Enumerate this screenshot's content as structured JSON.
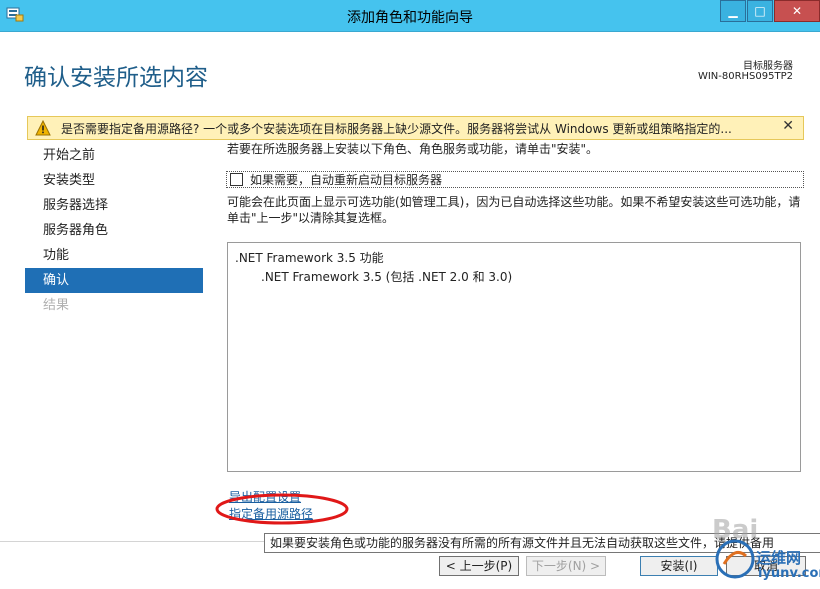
{
  "window": {
    "title": "添加角色和功能向导"
  },
  "header": {
    "page_title": "确认安装所选内容",
    "target_label": "目标服务器",
    "target_value": "WIN-80RHS095TP2"
  },
  "warning": {
    "text": "是否需要指定备用源路径? 一个或多个安装选项在目标服务器上缺少源文件。服务器将尝试从 Windows 更新或组策略指定的...",
    "close_glyph": "✕"
  },
  "nav": {
    "items": [
      {
        "label": "开始之前"
      },
      {
        "label": "安装类型"
      },
      {
        "label": "服务器选择"
      },
      {
        "label": "服务器角色"
      },
      {
        "label": "功能"
      },
      {
        "label": "确认"
      },
      {
        "label": "结果"
      }
    ]
  },
  "main": {
    "instruction": "若要在所选服务器上安装以下角色、角色服务或功能，请单击\"安装\"。",
    "restart_label": "如果需要，自动重新启动目标服务器",
    "note": "可能会在此页面上显示可选功能(如管理工具)，因为已自动选择这些功能。如果不希望安装这些可选功能，请单击\"上一步\"以清除其复选框。",
    "features": [
      {
        "name": ".NET Framework 3.5 功能"
      },
      {
        "name": ".NET Framework 3.5 (包括 .NET 2.0 和 3.0)"
      }
    ],
    "export_link": "导出配置设置",
    "alt_source_link": "指定备用源路径",
    "tooltip": "如果要安装角色或功能的服务器没有所需的所有源文件并且无法自动获取这些文件，请提供备用"
  },
  "buttons": {
    "prev": "< 上一步(P)",
    "next": "下一步(N) >",
    "install": "安装(I)",
    "cancel": "取消"
  },
  "watermark": {
    "baidu": "Bai",
    "site_cn": "运维网",
    "site_en": "iyunv.com"
  },
  "colors": {
    "titlebar": "#45c3ee",
    "accent": "#1f6fb5",
    "warning_bg": "#fff1b8",
    "link": "#1a5fa0",
    "annotation": "#e01818"
  }
}
